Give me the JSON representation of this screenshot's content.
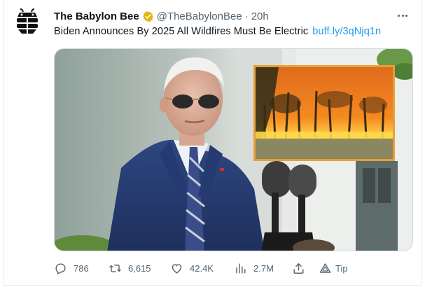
{
  "tweet": {
    "author": {
      "display_name": "The Babylon Bee",
      "handle": "@TheBabylonBee",
      "separator": "·",
      "time": "20h"
    },
    "text": "Biden Announces By 2025 All Wildfires Must Be Electric",
    "link": "buff.ly/3qNjq1n",
    "actions": {
      "replies": "786",
      "retweets": "6,615",
      "likes": "42.4K",
      "views": "2.7M",
      "tip": "Tip"
    }
  },
  "icons": {
    "avatar": "bee-logo-icon",
    "verified": "verified-badge-icon",
    "more": "more-dots-icon",
    "reply": "reply-icon",
    "retweet": "retweet-icon",
    "like": "heart-icon",
    "views": "analytics-icon",
    "share": "share-icon",
    "tip": "tip-icon"
  },
  "colors": {
    "link": "#1d9bf0",
    "muted": "#536471",
    "verified_gold": "#e2b719",
    "fire_frame": "#e8a038"
  }
}
